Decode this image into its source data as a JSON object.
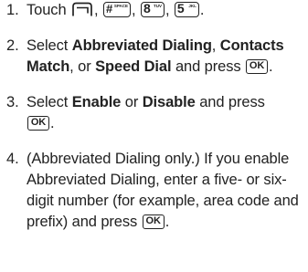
{
  "steps": [
    {
      "num": "1.",
      "parts": [
        "Touch",
        ",",
        ",",
        ",",
        "."
      ],
      "keys": {
        "hash_main": "#",
        "hash_sub": "SPACE",
        "eight_main": "8",
        "eight_sub": "TUV",
        "five_main": "5",
        "five_sub": "JKL"
      }
    },
    {
      "num": "2.",
      "t1": "Select",
      "b1": "Abbreviated Dialing",
      "t2": ",",
      "b2": "Contacts Match",
      "t3": ", or",
      "b3": "Speed Dial",
      "t4": "and press",
      "t5": "."
    },
    {
      "num": "3.",
      "t1": "Select",
      "b1": "Enable",
      "t2": "or",
      "b2": "Disable",
      "t3": "and press",
      "t4": "."
    },
    {
      "num": "4.",
      "text": "(Abbreviated Dialing only.) If you enable Abbreviated Dialing, enter a five- or six-digit number (for example, area code and prefix) and press",
      "end": "."
    }
  ],
  "ok_key_label": "OK"
}
